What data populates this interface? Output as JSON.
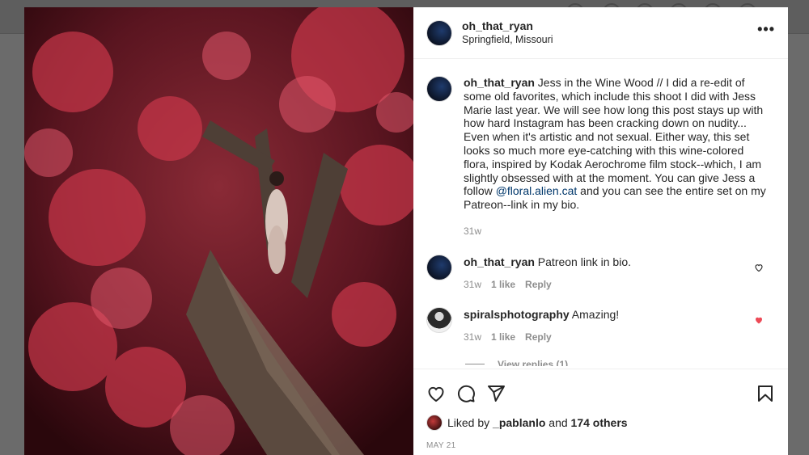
{
  "post": {
    "username": "oh_that_ryan",
    "location": "Springfield, Missouri",
    "more_label": "•••"
  },
  "comments": [
    {
      "username": "oh_that_ryan",
      "text_before": " Jess in the Wine Wood // I did a re-edit of some old favorites, which include this shoot I did with Jess Marie last year. We will see how long this post stays up with how hard Instagram has been cracking down on nudity... Even when it's artistic and not sexual. Either way, this set looks so much more eye-catching with this wine-colored flora, inspired by Kodak Aerochrome film stock--which, I am slightly obsessed with at the moment. You can give Jess a follow ",
      "mention": "@floral.alien.cat",
      "text_after": " and you can see the entire set on my Patreon--link in my bio.",
      "time": "31w"
    },
    {
      "username": "oh_that_ryan",
      "text": " Patreon link in bio.",
      "time": "31w",
      "likes": "1 like",
      "reply": "Reply"
    },
    {
      "username": "spiralsphotography",
      "text": " Amazing!",
      "time": "31w",
      "likes": "1 like",
      "reply": "Reply"
    }
  ],
  "view_replies": "View replies (1)",
  "liked": {
    "prefix": "Liked by ",
    "user": "_pablanlo",
    "mid": " and ",
    "others": "174 others"
  },
  "date": "MAY 21",
  "colors": {
    "like_red": "#ed4956",
    "link_blue": "#00376b",
    "muted": "#8e8e8e"
  },
  "icons": [
    "heart-icon",
    "comment-icon",
    "share-icon",
    "bookmark-icon"
  ]
}
